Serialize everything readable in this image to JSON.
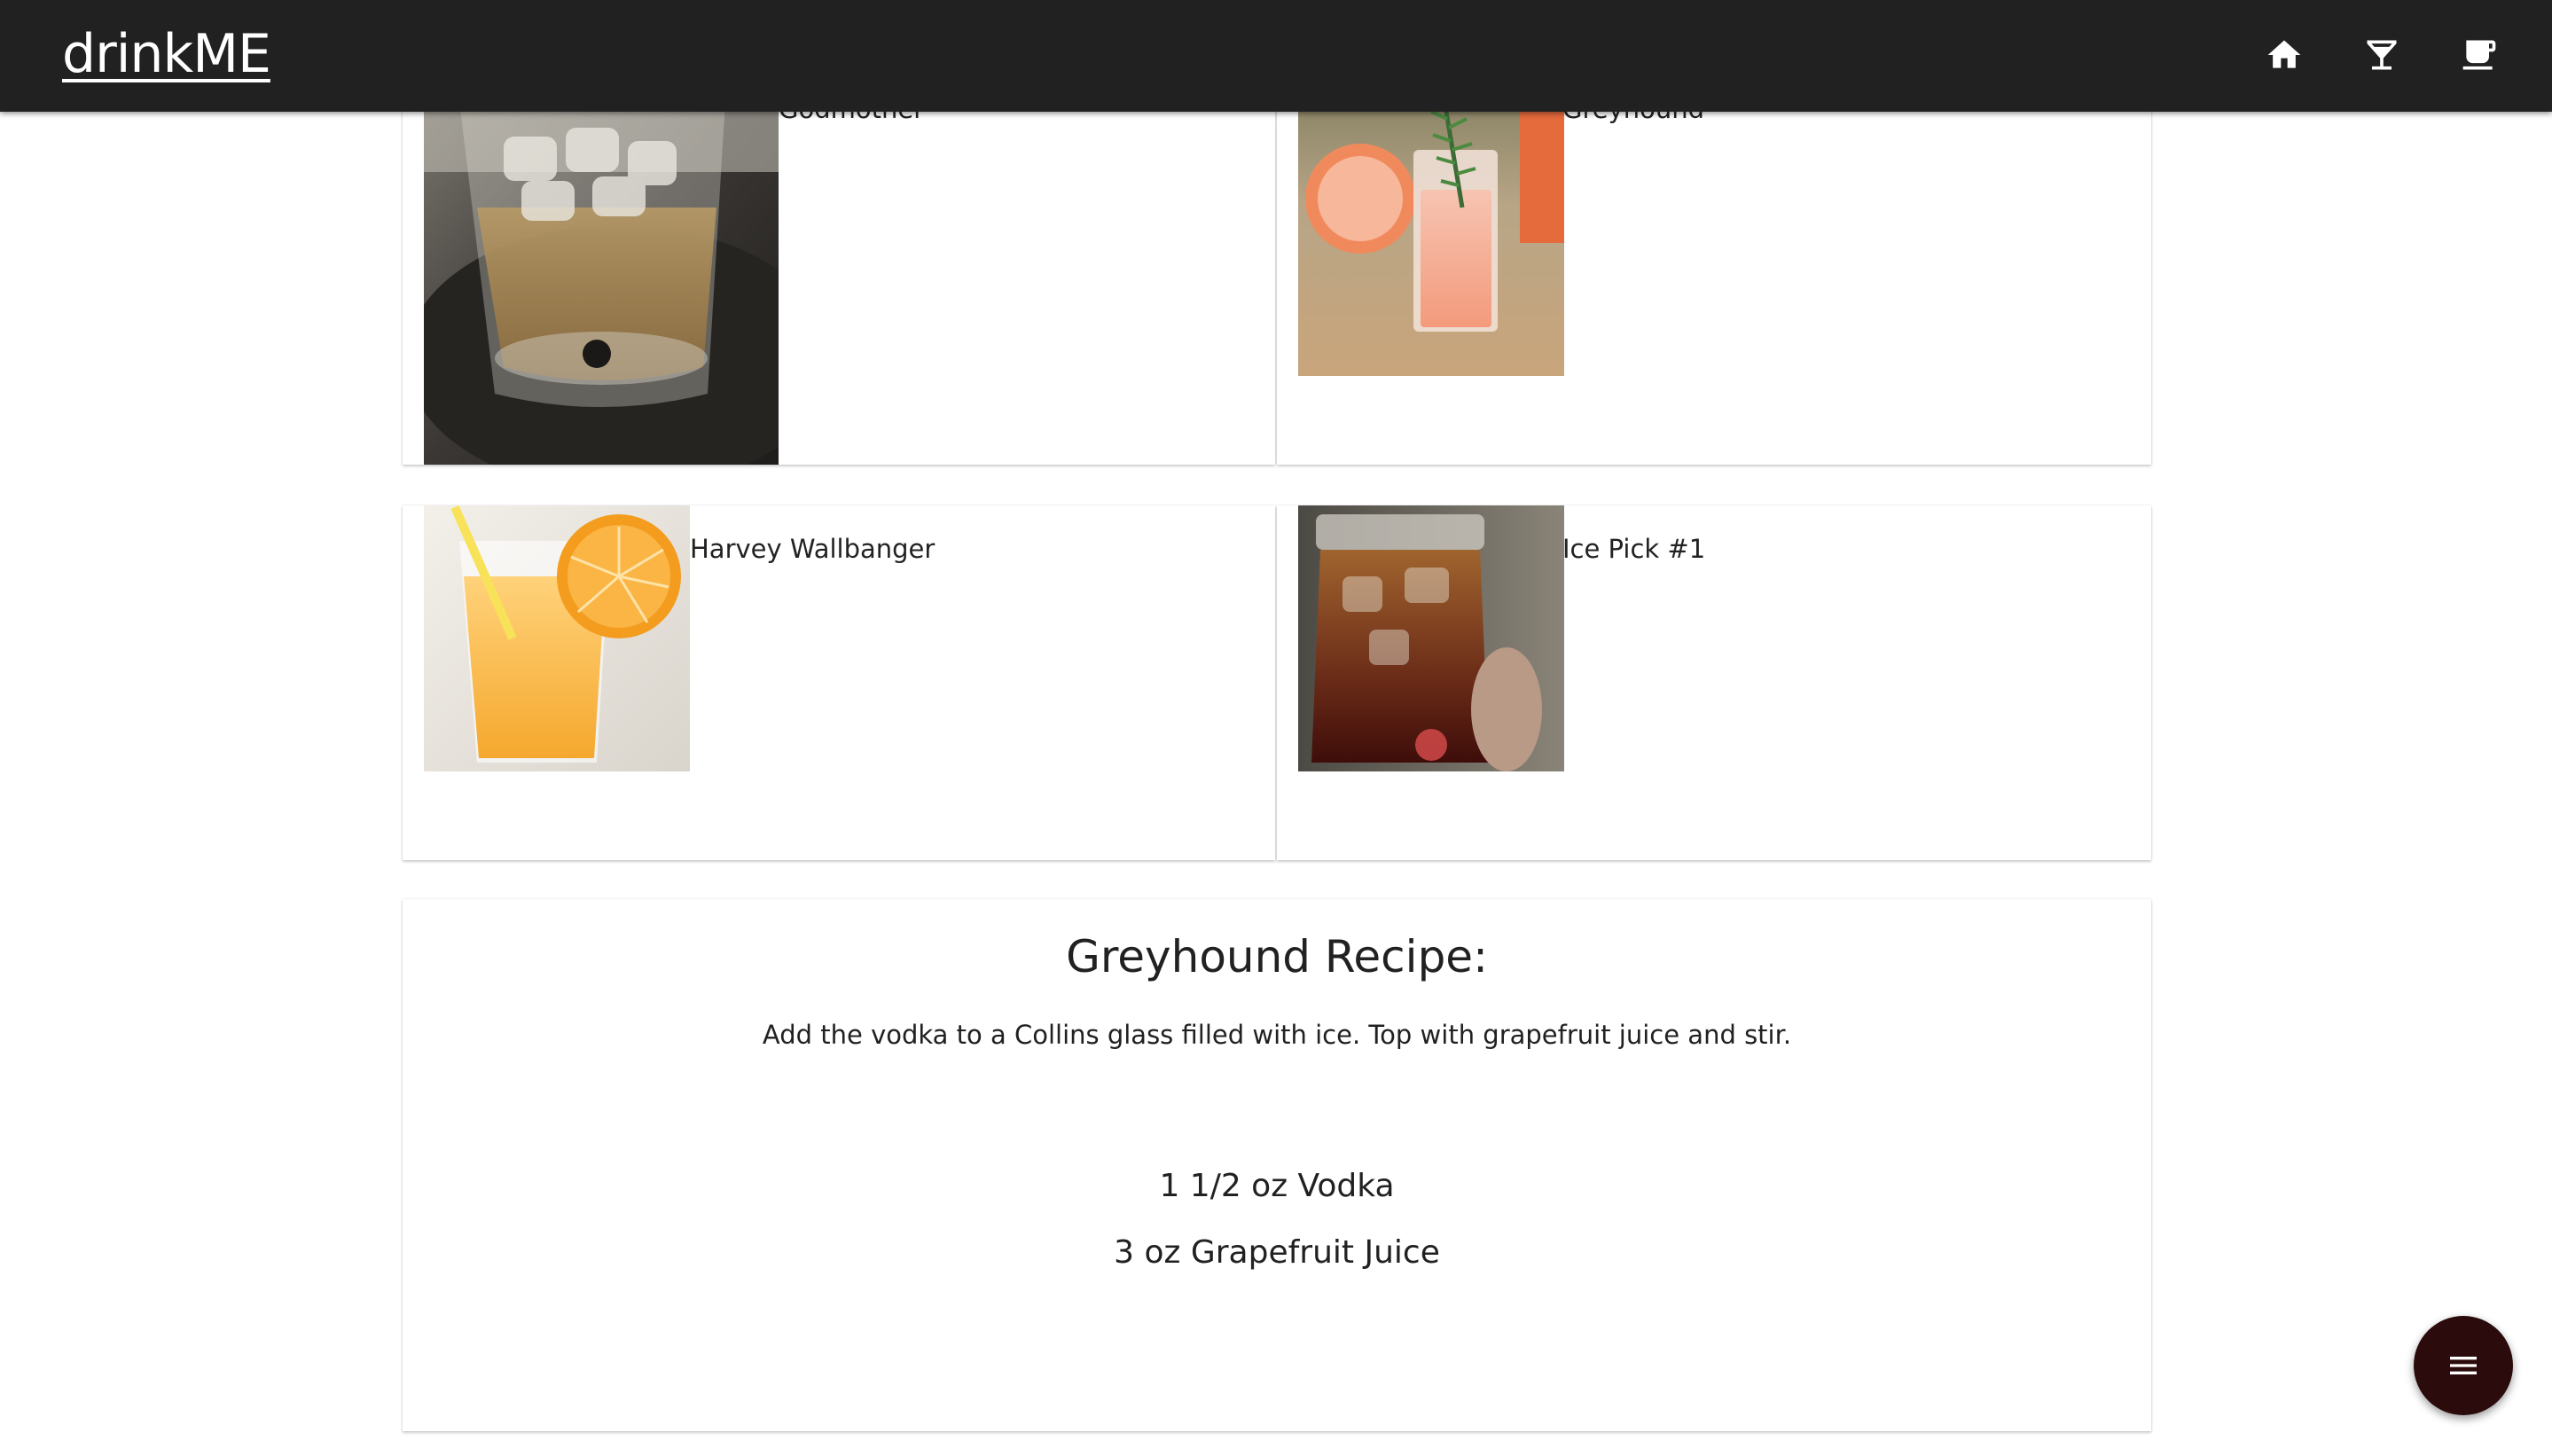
{
  "app": {
    "brand": "drinkME"
  },
  "nav": {
    "icons": [
      "home-icon",
      "cocktail-glass-icon",
      "coffee-cup-icon"
    ]
  },
  "drinks": [
    {
      "name": "Godmother",
      "image": "amber cocktail in rocks glass with ice"
    },
    {
      "name": "Greyhound",
      "image": "pink grapefruit cocktail with rosemary sprig"
    },
    {
      "name": "Harvey Wallbanger",
      "image": "orange drink with orange slice and straw"
    },
    {
      "name": "Ice Pick #1",
      "image": "dark iced tea drink in mason jar"
    }
  ],
  "recipe": {
    "title": "Greyhound Recipe:",
    "instructions": "Add the vodka to a Collins glass filled with ice. Top with grapefruit juice and stir.",
    "ingredients": [
      "1 1/2 oz Vodka",
      "3 oz Grapefruit Juice"
    ]
  },
  "fab": {
    "icon": "menu-icon"
  },
  "colors": {
    "topbar": "#212121",
    "fab": "#2b0b0b",
    "text": "#212121"
  }
}
